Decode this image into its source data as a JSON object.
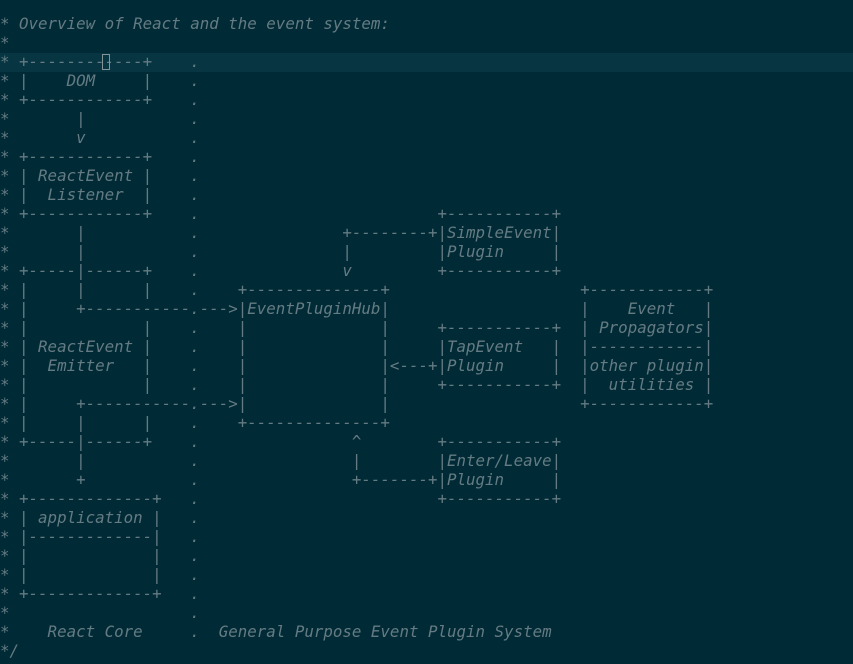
{
  "colors": {
    "background": "#002b36",
    "cursorline": "#073642",
    "comment_text": "#657b83",
    "cursor": "#839496"
  },
  "lines": [
    "* Overview of React and the event system:",
    "*",
    "* +------------+    .",
    "* |    DOM     |    .",
    "* +------------+    .",
    "*       |           .",
    "*       v           .",
    "* +------------+    .",
    "* | ReactEvent |    .",
    "* |  Listener  |    .",
    "* +------------+    .                         +-----------+",
    "*       |           .               +--------+|SimpleEvent|",
    "*       |           .               |         |Plugin     |",
    "* +-----|------+    .               v         +-----------+",
    "* |     |      |    .    +--------------+                    +------------+",
    "* |     +-----------.--->|EventPluginHub|                    |    Event   |",
    "* |            |    .    |              |     +-----------+  | Propagators|",
    "* | ReactEvent |    .    |              |     |TapEvent   |  |------------|",
    "* |  Emitter   |    .    |              |<---+|Plugin     |  |other plugin|",
    "* |            |    .    |              |     +-----------+  |  utilities |",
    "* |     +-----------.--->|              |                    +------------+",
    "* |     |      |    .    +--------------+",
    "* +-----|------+    .                ^        +-----------+",
    "*       |           .                |        |Enter/Leave|",
    "*       +           .                +-------+|Plugin     |",
    "* +-------------+   .                         +-----------+",
    "* | application |   .",
    "* |-------------|   .",
    "* |             |   .",
    "* |             |   .",
    "* +-------------+   .",
    "*                   .",
    "*    React Core     .  General Purpose Event Plugin System",
    "*/"
  ]
}
